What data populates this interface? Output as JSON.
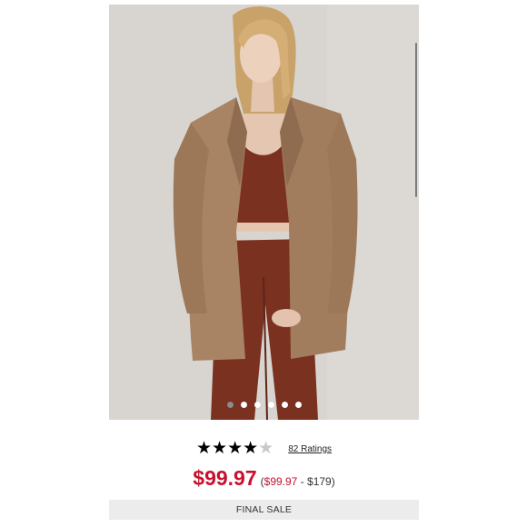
{
  "product": {
    "image_alt": "Model wearing tan oversized blazer with rust crop top and leggings",
    "carousel": {
      "count": 6,
      "active_index": 0
    },
    "rating": {
      "stars": 4,
      "max": 5,
      "ratings_label": "82 Ratings"
    },
    "price": {
      "current": "$99.97",
      "range_open": "(",
      "range_sale": "$99.97",
      "range_sep": " - ",
      "range_max": "$179",
      "range_close": ")"
    },
    "badge": "FINAL SALE"
  },
  "colors": {
    "sale_red": "#c8102e",
    "blazer": "#a88464",
    "top_and_leggings": "#7a3120"
  }
}
